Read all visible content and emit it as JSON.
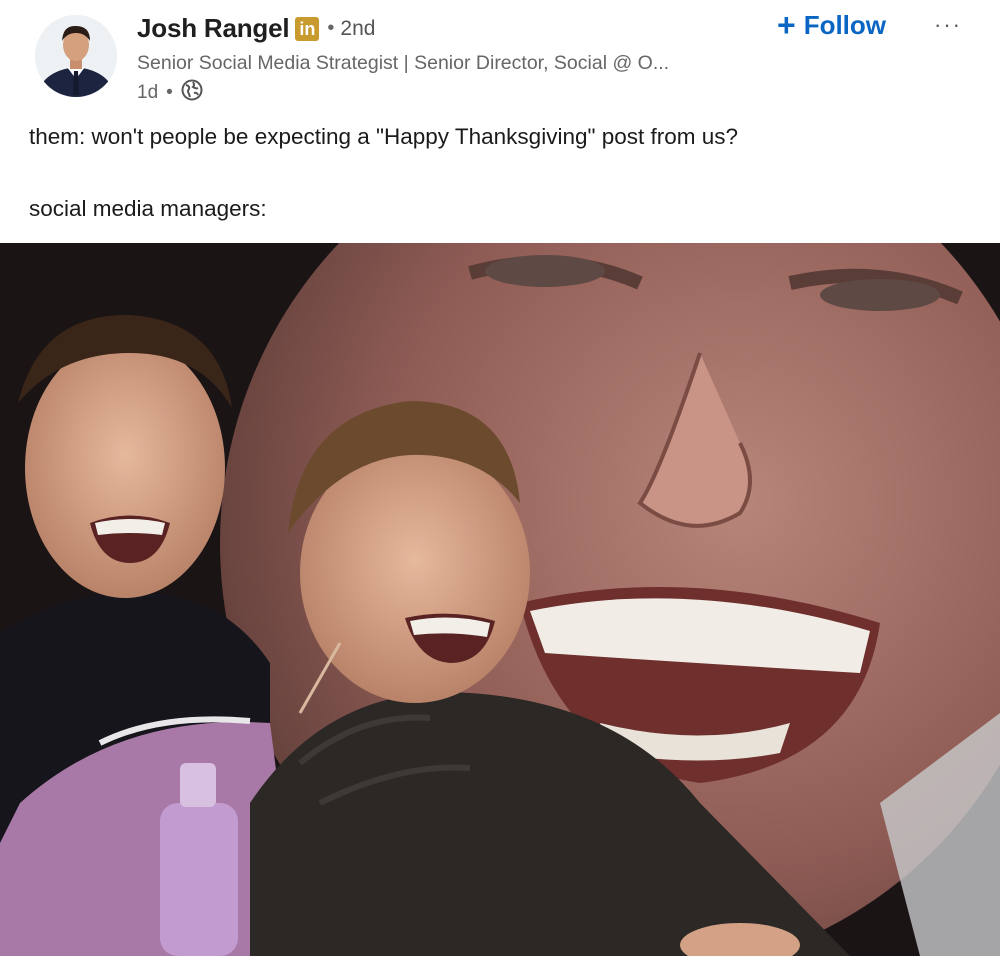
{
  "post": {
    "author": {
      "name": "Josh Rangel",
      "badge": "in",
      "degree_separator": "•",
      "degree": "2nd",
      "headline": "Senior Social Media Strategist | Senior Director, Social @ O...",
      "time": "1d",
      "time_separator": "•",
      "visibility_icon": "globe-icon"
    },
    "follow": {
      "icon": "+",
      "label": "Follow"
    },
    "more_icon": "···",
    "text": {
      "line1": "them: won't people be expecting a \"Happy Thanksgiving\" post from us?",
      "line2": "social media managers:"
    },
    "image": {
      "alt": "meme-photo"
    }
  },
  "colors": {
    "accent": "#0a66c2",
    "badge": "#c99a2e",
    "muted": "#666666"
  }
}
